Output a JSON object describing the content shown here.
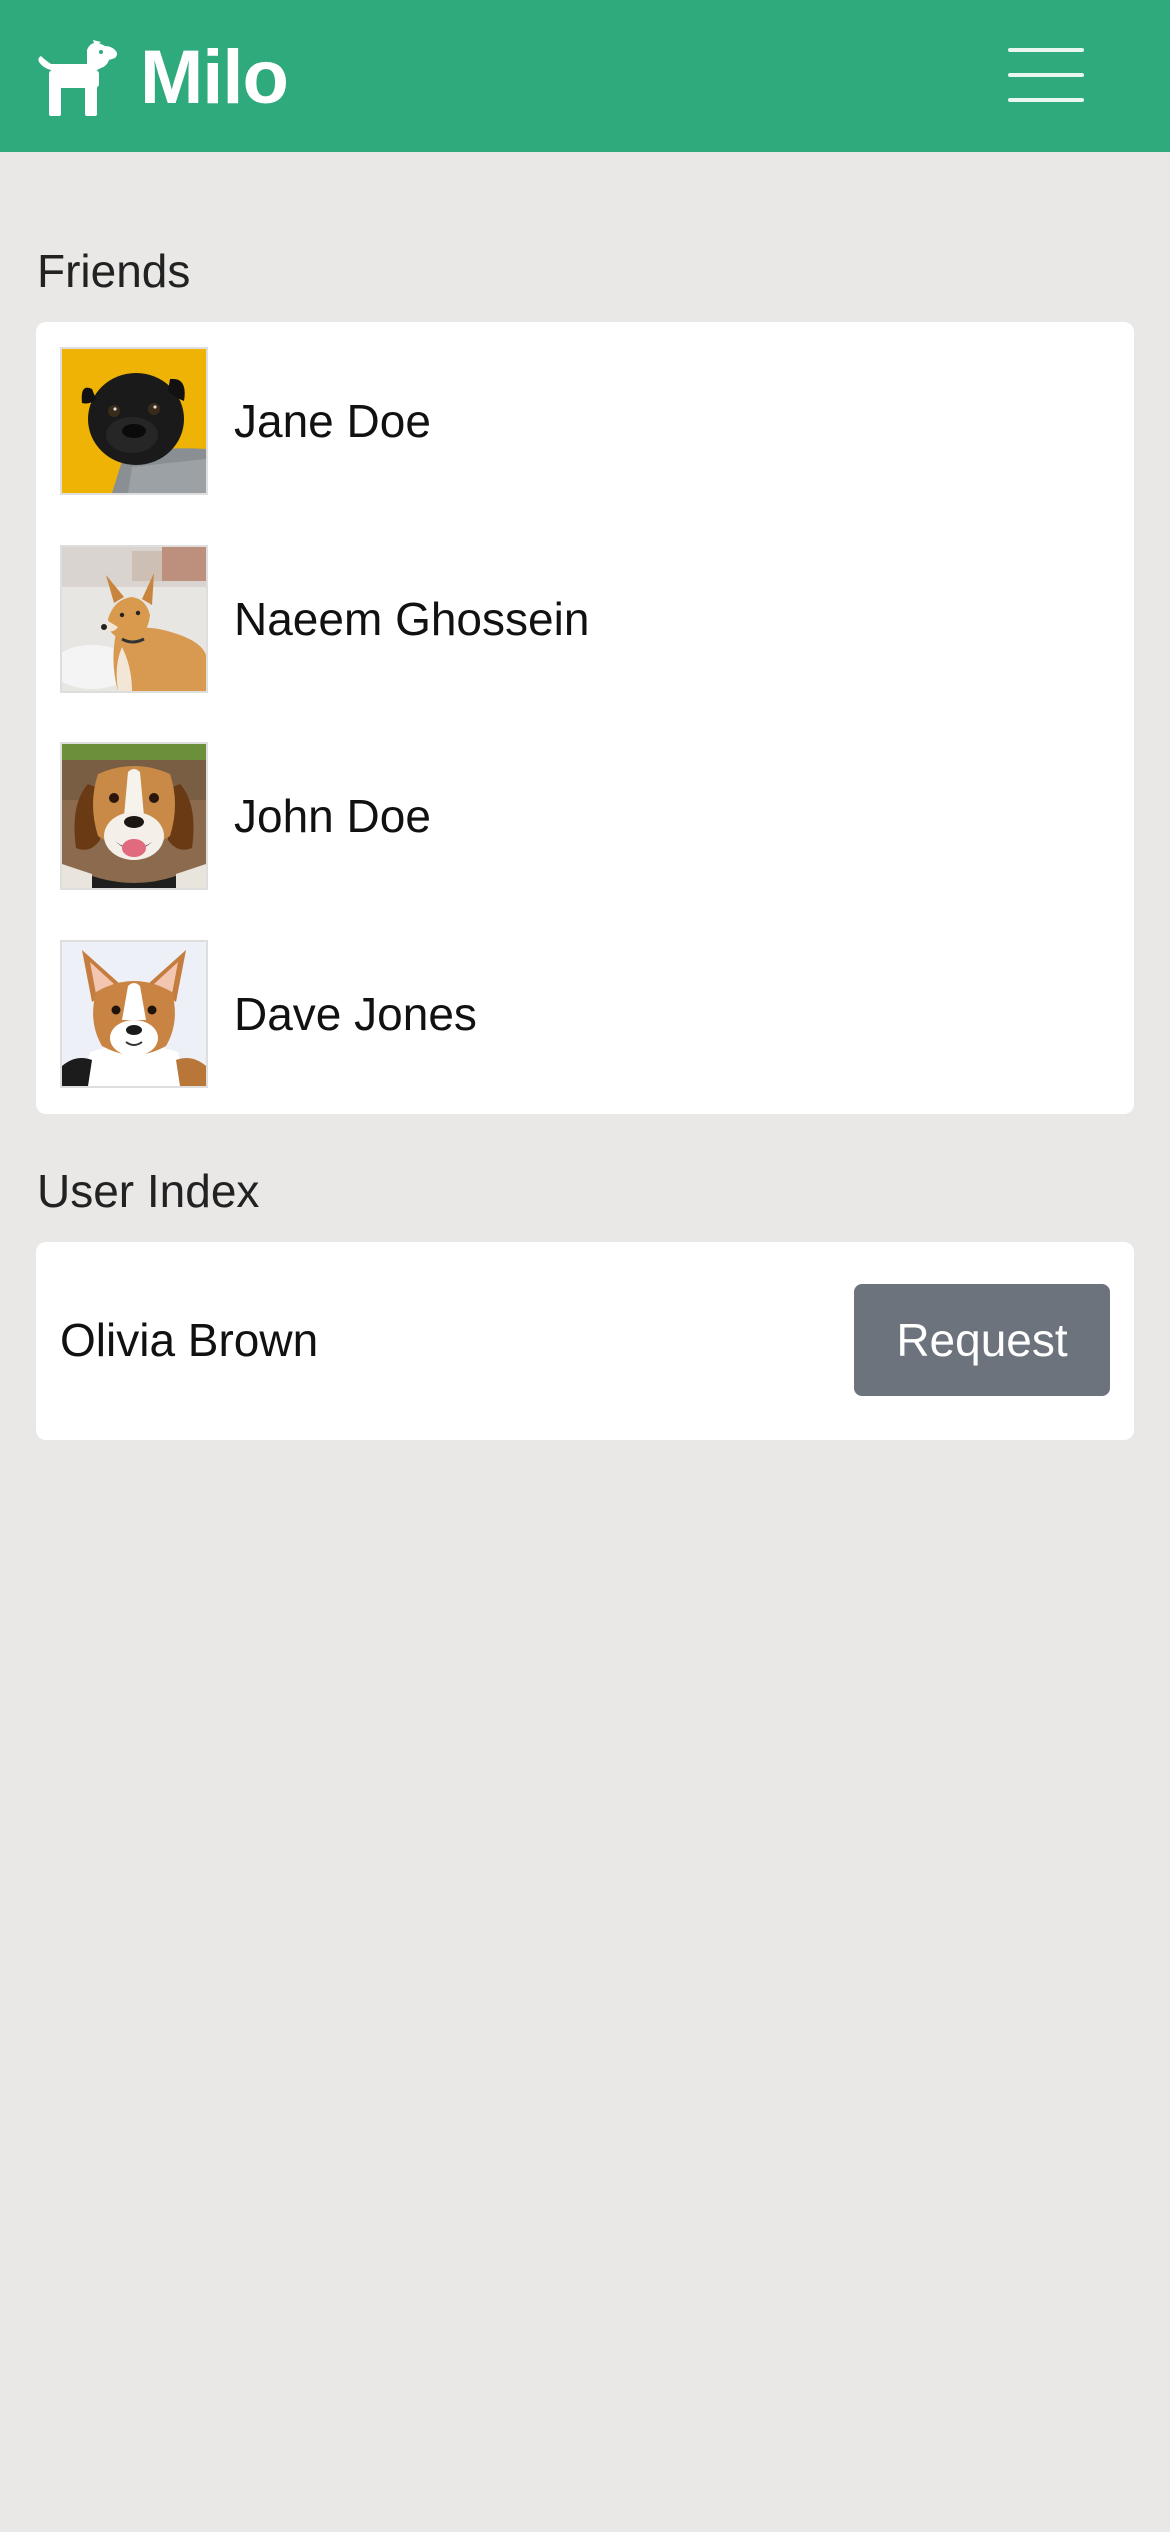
{
  "app": {
    "brand_name": "Milo",
    "brand_icon": "dog-icon",
    "menu_icon": "hamburger-menu-icon",
    "colors": {
      "navbar": "#2eaa7c",
      "page_background": "#e9e8e7",
      "card_background": "#ffffff",
      "request_button": "#6d737d"
    }
  },
  "friends": {
    "heading": "Friends",
    "items": [
      {
        "name": "Jane Doe",
        "avatar": "black-pug-on-yellow-photo"
      },
      {
        "name": "Naeem Ghossein",
        "avatar": "tan-dog-in-snow-photo"
      },
      {
        "name": "John Doe",
        "avatar": "beagle-photo"
      },
      {
        "name": "Dave Jones",
        "avatar": "corgi-photo"
      }
    ]
  },
  "user_index": {
    "heading": "User Index",
    "items": [
      {
        "name": "Olivia Brown",
        "action_label": "Request"
      }
    ]
  }
}
